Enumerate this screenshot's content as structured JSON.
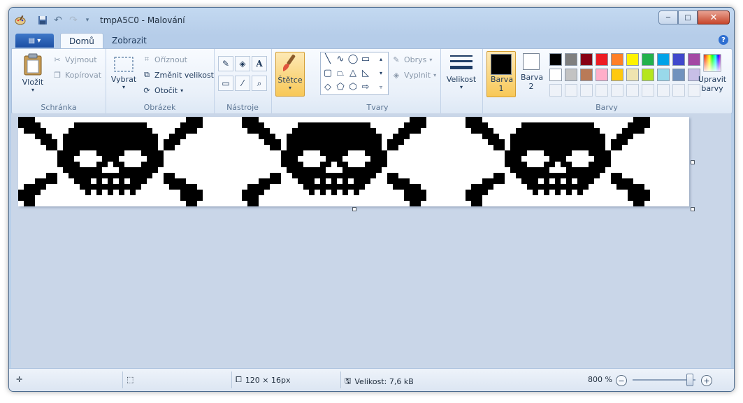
{
  "window": {
    "title": "tmpA5C0 - Malování",
    "controls": {
      "minimize": "─",
      "maximize": "□",
      "close": "✕"
    }
  },
  "tabs": [
    {
      "label": "Domů",
      "active": true
    },
    {
      "label": "Zobrazit",
      "active": false
    }
  ],
  "ribbon": {
    "clipboard": {
      "group_label": "Schránka",
      "paste": "Vložit",
      "cut": "Vyjmout",
      "copy": "Kopírovat"
    },
    "image": {
      "group_label": "Obrázek",
      "select": "Vybrat",
      "crop": "Oříznout",
      "resize": "Změnit velikost",
      "rotate": "Otočit"
    },
    "tools": {
      "group_label": "Nástroje"
    },
    "brushes": {
      "label": "Štětce"
    },
    "shapes": {
      "group_label": "Tvary",
      "outline": "Obrys",
      "fill": "Vyplnit"
    },
    "size": {
      "label": "Velikost"
    },
    "colors": {
      "group_label": "Barvy",
      "color1_label": "Barva 1",
      "color2_label": "Barva 2",
      "edit_label": "Upravit barvy",
      "color1": "#000000",
      "color2": "#ffffff",
      "palette_row1": [
        "#000000",
        "#7f7f7f",
        "#880015",
        "#ed1c24",
        "#ff7f27",
        "#fff200",
        "#22b14c",
        "#00a2e8",
        "#3f48cc",
        "#a349a4"
      ],
      "palette_row2": [
        "#ffffff",
        "#c3c3c3",
        "#b97a57",
        "#ffaec9",
        "#ffc90e",
        "#efe4b0",
        "#b5e61d",
        "#99d9ea",
        "#7092be",
        "#c8bfe7"
      ]
    }
  },
  "image": {
    "pattern": "skull-and-crossbones",
    "tiles": 3,
    "foreground": "#000000",
    "background": "#ffffff"
  },
  "status": {
    "dimensions": "120 × 16px",
    "file_size": "Velikost: 7,6 kB",
    "zoom": "800 %",
    "zoom_level_fraction": 0.9
  }
}
